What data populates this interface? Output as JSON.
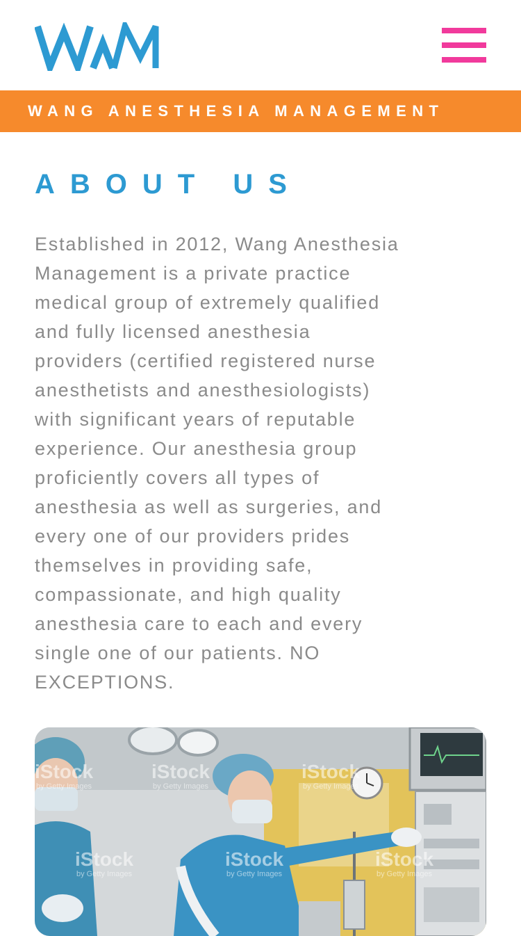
{
  "header": {
    "logo_text": "WAM",
    "menu_icon": "hamburger-menu-icon",
    "colors": {
      "logo": "#2d9ad2",
      "menu": "#f13a9c"
    }
  },
  "tagline": {
    "text": "WANG ANESTHESIA MANAGEMENT",
    "background": "#f68a2c"
  },
  "about": {
    "heading": "ABOUT US",
    "body": "Established in 2012, Wang Anesthesia\nManagement is a private practice\nmedical group of extremely qualified\nand fully licensed anesthesia\nproviders (certified registered nurse\nanesthetists and anesthesiologists)\nwith significant years of reputable\nexperience.  Our anesthesia group\nproficiently covers all types of\nanesthesia as well as surgeries, and\nevery one of our providers prides\nthemselves in providing safe,\ncompassionate, and high quality\nanesthesia care to each and every\nsingle one of our patients.  NO\nEXCEPTIONS."
  },
  "photo": {
    "watermark_main": "iStock",
    "watermark_sub": "by Getty Images"
  }
}
